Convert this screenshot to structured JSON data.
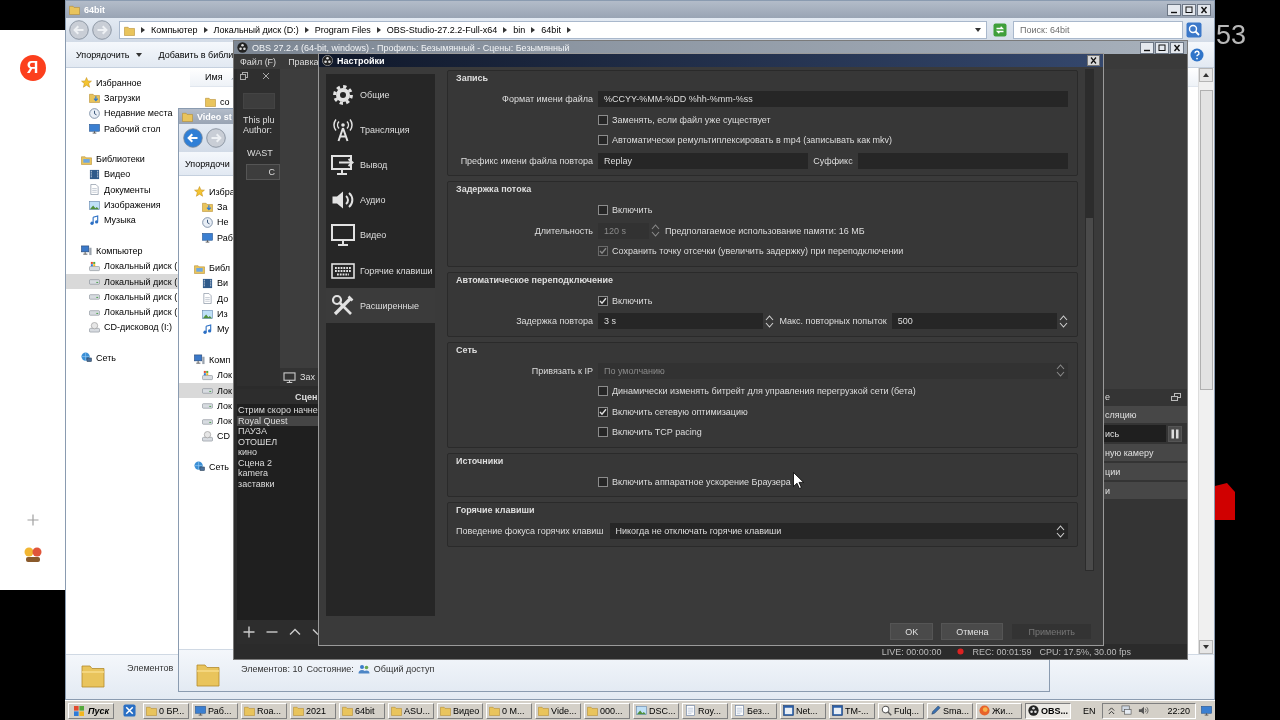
{
  "browser_panel": {
    "logo": "Я"
  },
  "video_overlay": {
    "text": "53"
  },
  "explorers": [
    {
      "title": "64bit",
      "back_enabled": false,
      "breadcrumb": [
        "Компьютер",
        "Локальный диск (D:)",
        "Program Files",
        "OBS-Studio-27.2.2-Full-x64",
        "bin",
        "64bit"
      ],
      "search": {
        "placeholder": "Поиск: 64bit"
      },
      "toolbar": [
        {
          "label": "Упорядочить",
          "dropdown": true
        },
        {
          "label": "Добавить в библи",
          "dropdown": false
        }
      ],
      "nav": [
        {
          "label": "Избранное",
          "kind": "star",
          "selected": false,
          "children": [
            {
              "label": "Загрузки",
              "kind": "downloads",
              "selected": false
            },
            {
              "label": "Недавние места",
              "kind": "recent",
              "selected": false
            },
            {
              "label": "Рабочий стол",
              "kind": "desktop",
              "selected": false
            }
          ]
        },
        {
          "label": "Библиотеки",
          "kind": "library",
          "selected": false,
          "children": [
            {
              "label": "Видео",
              "kind": "video",
              "selected": false
            },
            {
              "label": "Документы",
              "kind": "document",
              "selected": false
            },
            {
              "label": "Изображения",
              "kind": "image",
              "selected": false
            },
            {
              "label": "Музыка",
              "kind": "music",
              "selected": false
            }
          ]
        },
        {
          "label": "Компьютер",
          "kind": "computer",
          "selected": false,
          "children": [
            {
              "label": "Локальный диск (",
              "kind": "system_drive",
              "selected": false
            },
            {
              "label": "Локальный диск (",
              "kind": "drive",
              "selected": true
            },
            {
              "label": "Локальный диск (",
              "kind": "drive",
              "selected": false
            },
            {
              "label": "Локальный диск (",
              "kind": "drive",
              "selected": false
            },
            {
              "label": "CD-дисковод (I:)",
              "kind": "cd",
              "selected": false
            }
          ]
        },
        {
          "label": "Сеть",
          "kind": "network",
          "selected": false
        }
      ],
      "columns": [
        "Имя"
      ],
      "files": [
        "co"
      ],
      "details": {
        "count": "Элементов"
      }
    },
    {
      "title": "Video st",
      "back_enabled": true,
      "toolbar": [
        {
          "label": "Упорядочи",
          "dropdown": false
        }
      ],
      "nav": [
        {
          "label": "Избра",
          "kind": "star",
          "selected": false,
          "children": [
            {
              "label": "За",
              "kind": "downloads",
              "selected": false
            },
            {
              "label": "Не",
              "kind": "recent",
              "selected": false
            },
            {
              "label": "Раб",
              "kind": "desktop",
              "selected": false
            }
          ]
        },
        {
          "label": "Библ",
          "kind": "library",
          "selected": false,
          "children": [
            {
              "label": "Ви",
              "kind": "video",
              "selected": false
            },
            {
              "label": "До",
              "kind": "document",
              "selected": false
            },
            {
              "label": "Из",
              "kind": "image",
              "selected": false
            },
            {
              "label": "Му",
              "kind": "music",
              "selected": false
            }
          ]
        },
        {
          "label": "Комп",
          "kind": "computer",
          "selected": false,
          "children": [
            {
              "label": "Лок",
              "kind": "system_drive",
              "selected": false
            },
            {
              "label": "Лок",
              "kind": "drive",
              "selected": true
            },
            {
              "label": "Лок",
              "kind": "drive",
              "selected": false
            },
            {
              "label": "Лок",
              "kind": "drive",
              "selected": false
            },
            {
              "label": "CD",
              "kind": "cd",
              "selected": false
            }
          ]
        },
        {
          "label": "Сеть",
          "kind": "network",
          "selected": false
        }
      ],
      "details": {
        "count": "Элементов: 10",
        "state_label": "Состояние:",
        "state": "Общий доступ"
      }
    }
  ],
  "obs": {
    "title": "OBS 27.2.4 (64-bit, windows) - Профиль: Безымянный - Сцены: Безымянный",
    "menu": [
      "Файл (F)",
      "Правка"
    ],
    "plugin_dock": {
      "lines": [
        "This plu",
        "Author:"
      ],
      "heading": "WAST",
      "button": "C"
    },
    "source_toolbar": {
      "label": "Зах"
    },
    "scenes": {
      "title": "Сцен",
      "items": [
        {
          "label": "Стрим скоро начне",
          "selected": false
        },
        {
          "label": "Royal Quest",
          "selected": true
        },
        {
          "label": "ПАУЗА",
          "selected": false
        },
        {
          "label": "ОТОШЕЛ",
          "selected": false
        },
        {
          "label": "кино",
          "selected": false
        },
        {
          "label": "Сцена 2",
          "selected": false
        },
        {
          "label": "kamera",
          "selected": false
        },
        {
          "label": "заставки",
          "selected": false
        }
      ]
    },
    "controls": {
      "title": "е",
      "buttons": [
        {
          "label": "сляцию",
          "checked": false
        },
        {
          "label": "ись",
          "checked": true
        },
        {
          "label": "ную камеру",
          "checked": false
        },
        {
          "label": "ции",
          "checked": false
        },
        {
          "label": "и",
          "checked": false
        }
      ]
    },
    "status": {
      "live": "LIVE: 00:00:00",
      "rec": "REC: 00:01:59",
      "cpu": "CPU: 17.5%, 30.00 fps"
    }
  },
  "settings": {
    "title": "Настройки",
    "categories": [
      {
        "label": "Общие",
        "kind": "general",
        "selected": false
      },
      {
        "label": "Трансляция",
        "kind": "stream",
        "selected": false
      },
      {
        "label": "Вывод",
        "kind": "output",
        "selected": false
      },
      {
        "label": "Аудио",
        "kind": "audio",
        "selected": false
      },
      {
        "label": "Видео",
        "kind": "video",
        "selected": false
      },
      {
        "label": "Горячие клавиши",
        "kind": "hotkeys",
        "selected": false
      },
      {
        "label": "Расширенные",
        "kind": "advanced",
        "selected": true
      }
    ],
    "groups": [
      {
        "title": "Запись",
        "wide_labels": false,
        "rows": [
          {
            "kind": "text",
            "label": "Формат имени файла",
            "value": "%CCYY-%MM-%DD %hh-%mm-%ss",
            "disabled": false
          },
          {
            "kind": "check",
            "label": "Заменять, если файл уже существует",
            "checked": false,
            "disabled": false
          },
          {
            "kind": "check",
            "label": "Автоматически ремультиплексировать в mp4 (записывать как mkv)",
            "checked": false,
            "disabled": false
          },
          {
            "kind": "pair",
            "label": "Префикс имени файла повтора",
            "value": "Replay",
            "label2": "Суффикс",
            "disabled": false
          }
        ]
      },
      {
        "title": "Задержка потока",
        "wide_labels": false,
        "rows": [
          {
            "kind": "check",
            "label": "Включить",
            "checked": false,
            "disabled": false
          },
          {
            "kind": "spin",
            "label": "Длительность",
            "value": "120 s",
            "note": "Предполагаемое использование памяти: 16 МБ",
            "disabled": true
          },
          {
            "kind": "check",
            "label": "Сохранить точку отсечки (увеличить задержку) при переподключении",
            "checked": true,
            "disabled": true
          }
        ]
      },
      {
        "title": "Автоматическое переподключение",
        "wide_labels": false,
        "rows": [
          {
            "kind": "check",
            "label": "Включить",
            "checked": true,
            "disabled": false
          },
          {
            "kind": "spin_pair",
            "label": "Задержка повтора",
            "value": "3 s",
            "label2": "Макс. повторных попыток",
            "value2": "500",
            "disabled": false
          }
        ]
      },
      {
        "title": "Сеть",
        "wide_labels": false,
        "rows": [
          {
            "kind": "select",
            "label": "Привязать к IP",
            "value": "По умолчанию",
            "disabled": true
          },
          {
            "kind": "check",
            "label": "Динамически изменять битрейт для управления перегрузкой сети (бета)",
            "checked": false,
            "disabled": false
          },
          {
            "kind": "check",
            "label": "Включить сетевую оптимизацию",
            "checked": true,
            "disabled": false
          },
          {
            "kind": "check",
            "label": "Включить TCP pacing",
            "checked": false,
            "disabled": false
          }
        ]
      },
      {
        "title": "Источники",
        "wide_labels": false,
        "rows": [
          {
            "kind": "check",
            "label": "Включить аппаратное ускорение Браузера",
            "checked": false,
            "disabled": false
          }
        ]
      },
      {
        "title": "Горячие клавиши",
        "wide_labels": true,
        "rows": [
          {
            "kind": "select",
            "label": "Поведение фокуса горячих клавиш",
            "value": "Никогда не отключать горячие клавиши",
            "disabled": false
          }
        ]
      }
    ],
    "buttons": [
      {
        "label": "OK",
        "disabled": false
      },
      {
        "label": "Отмена",
        "disabled": false
      },
      {
        "label": "Применить",
        "disabled": true
      }
    ]
  },
  "taskbar": {
    "start": "Пуск",
    "tasks": [
      {
        "label": "0 БР...",
        "kind": "folder",
        "selected": false
      },
      {
        "label": "Раб...",
        "kind": "desktop",
        "selected": false
      },
      {
        "label": "Roa...",
        "kind": "folder",
        "selected": false
      },
      {
        "label": "2021",
        "kind": "folder",
        "selected": false
      },
      {
        "label": "64bit",
        "kind": "folder",
        "selected": false
      },
      {
        "label": "ASU...",
        "kind": "folder",
        "selected": false
      },
      {
        "label": "Видео",
        "kind": "folder",
        "selected": false
      },
      {
        "label": "0 M...",
        "kind": "folder",
        "selected": false
      },
      {
        "label": "Vide...",
        "kind": "folder",
        "selected": false
      },
      {
        "label": "000...",
        "kind": "folder",
        "selected": false
      },
      {
        "label": "DSC...",
        "kind": "photo",
        "selected": false
      },
      {
        "label": "Roy...",
        "kind": "notepad",
        "selected": false
      },
      {
        "label": "Без...",
        "kind": "notepad",
        "selected": false
      },
      {
        "label": "Net...",
        "kind": "window",
        "selected": false
      },
      {
        "label": "TM-...",
        "kind": "window",
        "selected": false
      },
      {
        "label": "Fulq...",
        "kind": "search",
        "selected": false
      },
      {
        "label": "Sma...",
        "kind": "pen",
        "selected": false
      },
      {
        "label": "Жи...",
        "kind": "browser",
        "selected": false
      },
      {
        "label": "OBS...",
        "kind": "obs",
        "selected": true
      }
    ],
    "language": "EN",
    "clock": "22:20"
  }
}
